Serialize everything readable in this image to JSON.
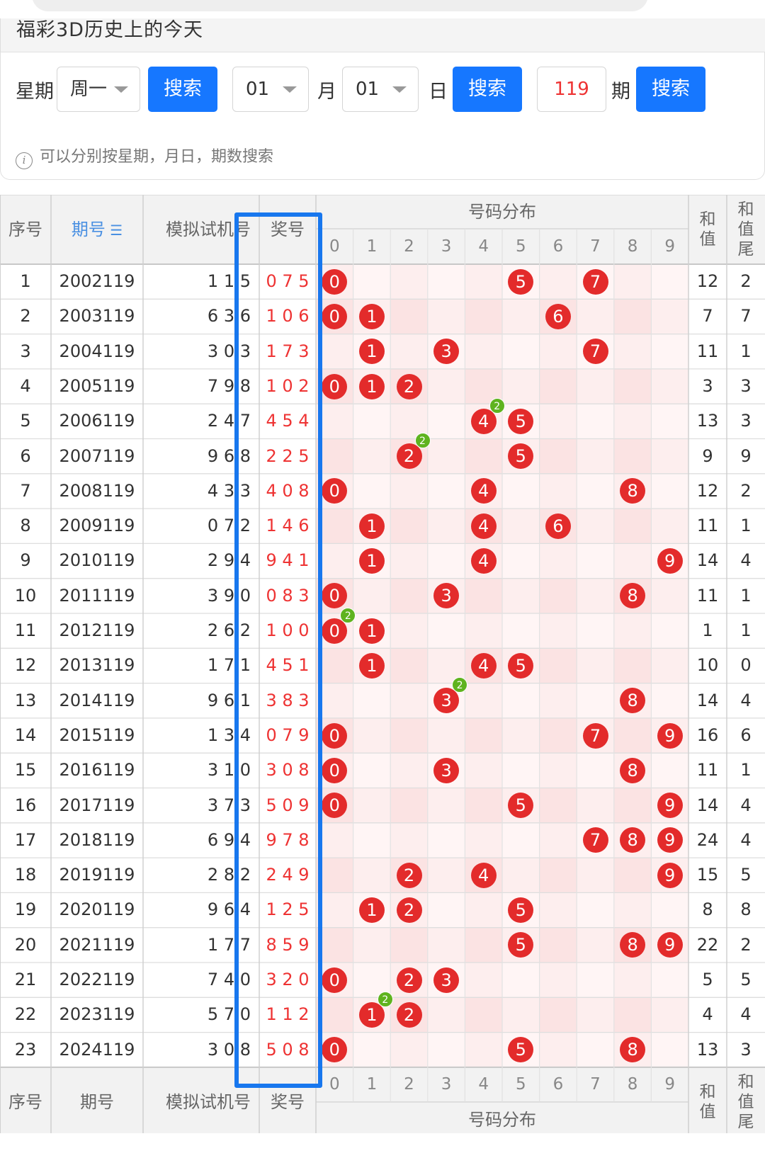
{
  "header": {
    "title": "福彩3D历史上的今天"
  },
  "search": {
    "weekday_label": "星期",
    "weekday_value": "周一",
    "search1": "搜索",
    "month_value": "01",
    "month_label": "月",
    "day_value": "01",
    "day_label": "日",
    "search2": "搜索",
    "period_value": "119",
    "period_label": "期",
    "search3": "搜索",
    "tip": "可以分别按星期，月日，期数搜索"
  },
  "table": {
    "head": {
      "idx": "序号",
      "period": "期号",
      "sim": "模拟试机号",
      "win": "奖号",
      "dist": "号码分布",
      "sum": "和值",
      "tail": "和值尾",
      "sort_icon": "sort-icon"
    },
    "digits": [
      "0",
      "1",
      "2",
      "3",
      "4",
      "5",
      "6",
      "7",
      "8",
      "9"
    ],
    "rows": [
      {
        "idx": "1",
        "period": "2002119",
        "sim": "1 1 5",
        "win": "0 7 5",
        "nums": [
          0,
          5,
          7
        ],
        "sum": "12",
        "tail": "2"
      },
      {
        "idx": "2",
        "period": "2003119",
        "sim": "6 3 6",
        "win": "1 0 6",
        "nums": [
          0,
          1,
          6
        ],
        "sum": "7",
        "tail": "7"
      },
      {
        "idx": "3",
        "period": "2004119",
        "sim": "3 0 3",
        "win": "1 7 3",
        "nums": [
          1,
          3,
          7
        ],
        "sum": "11",
        "tail": "1"
      },
      {
        "idx": "4",
        "period": "2005119",
        "sim": "7 9 8",
        "win": "1 0 2",
        "nums": [
          0,
          1,
          2
        ],
        "sum": "3",
        "tail": "3"
      },
      {
        "idx": "5",
        "period": "2006119",
        "sim": "2 4 7",
        "win": "4 5 4",
        "nums": [
          4,
          5
        ],
        "double": 4,
        "sum": "13",
        "tail": "3"
      },
      {
        "idx": "6",
        "period": "2007119",
        "sim": "9 6 8",
        "win": "2 2 5",
        "nums": [
          2,
          5
        ],
        "double": 2,
        "sum": "9",
        "tail": "9"
      },
      {
        "idx": "7",
        "period": "2008119",
        "sim": "4 3 3",
        "win": "4 0 8",
        "nums": [
          0,
          4,
          8
        ],
        "sum": "12",
        "tail": "2"
      },
      {
        "idx": "8",
        "period": "2009119",
        "sim": "0 7 2",
        "win": "1 4 6",
        "nums": [
          1,
          4,
          6
        ],
        "sum": "11",
        "tail": "1"
      },
      {
        "idx": "9",
        "period": "2010119",
        "sim": "2 9 4",
        "win": "9 4 1",
        "nums": [
          1,
          4,
          9
        ],
        "sum": "14",
        "tail": "4"
      },
      {
        "idx": "10",
        "period": "2011119",
        "sim": "3 9 0",
        "win": "0 8 3",
        "nums": [
          0,
          3,
          8
        ],
        "sum": "11",
        "tail": "1"
      },
      {
        "idx": "11",
        "period": "2012119",
        "sim": "2 6 2",
        "win": "1 0 0",
        "nums": [
          0,
          1
        ],
        "double": 0,
        "sum": "1",
        "tail": "1"
      },
      {
        "idx": "12",
        "period": "2013119",
        "sim": "1 7 1",
        "win": "4 5 1",
        "nums": [
          1,
          4,
          5
        ],
        "sum": "10",
        "tail": "0"
      },
      {
        "idx": "13",
        "period": "2014119",
        "sim": "9 6 1",
        "win": "3 8 3",
        "nums": [
          3,
          8
        ],
        "double": 3,
        "sum": "14",
        "tail": "4"
      },
      {
        "idx": "14",
        "period": "2015119",
        "sim": "1 3 4",
        "win": "0 7 9",
        "nums": [
          0,
          7,
          9
        ],
        "sum": "16",
        "tail": "6"
      },
      {
        "idx": "15",
        "period": "2016119",
        "sim": "3 1 0",
        "win": "3 0 8",
        "nums": [
          0,
          3,
          8
        ],
        "sum": "11",
        "tail": "1"
      },
      {
        "idx": "16",
        "period": "2017119",
        "sim": "3 7 3",
        "win": "5 0 9",
        "nums": [
          0,
          5,
          9
        ],
        "sum": "14",
        "tail": "4"
      },
      {
        "idx": "17",
        "period": "2018119",
        "sim": "6 9 4",
        "win": "9 7 8",
        "nums": [
          7,
          8,
          9
        ],
        "sum": "24",
        "tail": "4"
      },
      {
        "idx": "18",
        "period": "2019119",
        "sim": "2 8 2",
        "win": "2 4 9",
        "nums": [
          2,
          4,
          9
        ],
        "sum": "15",
        "tail": "5"
      },
      {
        "idx": "19",
        "period": "2020119",
        "sim": "9 6 4",
        "win": "1 2 5",
        "nums": [
          1,
          2,
          5
        ],
        "sum": "8",
        "tail": "8"
      },
      {
        "idx": "20",
        "period": "2021119",
        "sim": "1 7 7",
        "win": "8 5 9",
        "nums": [
          5,
          8,
          9
        ],
        "sum": "22",
        "tail": "2"
      },
      {
        "idx": "21",
        "period": "2022119",
        "sim": "7 4 0",
        "win": "3 2 0",
        "nums": [
          0,
          2,
          3
        ],
        "sum": "5",
        "tail": "5"
      },
      {
        "idx": "22",
        "period": "2023119",
        "sim": "5 7 0",
        "win": "1 1 2",
        "nums": [
          1,
          2
        ],
        "double": 1,
        "sum": "4",
        "tail": "4"
      },
      {
        "idx": "23",
        "period": "2024119",
        "sim": "3 0 8",
        "win": "5 0 8",
        "nums": [
          0,
          5,
          8
        ],
        "sum": "13",
        "tail": "3"
      }
    ],
    "double_badge": "2"
  },
  "colors": {
    "accent": "#1677ff",
    "ball": "#e32b2b",
    "badge": "#5fb31f",
    "win_text": "#e33",
    "highlight_frame": "#1877ee"
  }
}
